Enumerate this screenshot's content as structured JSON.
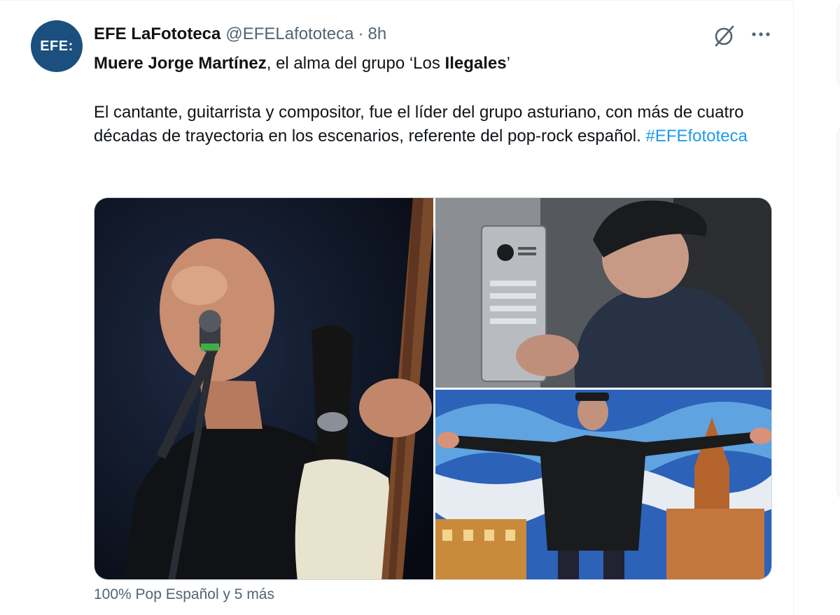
{
  "tweet": {
    "avatar_text": "EFE:",
    "author_name": "EFE LaFototeca",
    "handle": "@EFELafototeca",
    "separator": "·",
    "time": "8h",
    "headline_bold_1": "Muere Jorge Martínez",
    "headline_mid": ", el alma del grupo ‘Los ",
    "headline_bold_2": "Ilegales",
    "headline_end": "’",
    "body": "El cantante, guitarrista y compositor, fue el líder del grupo asturiano, con más de cuatro décadas de trayectoria en los escenarios, referente del pop-rock español. ",
    "hashtag": "#EFEfototeca",
    "tagged_people": "100% Pop Español y 5 más"
  },
  "icons": {
    "grok": "grok-icon",
    "more": "more-icon"
  },
  "colors": {
    "accent": "#1d9bf0",
    "avatar_bg": "#1b4f7e",
    "secondary_text": "#536471"
  }
}
